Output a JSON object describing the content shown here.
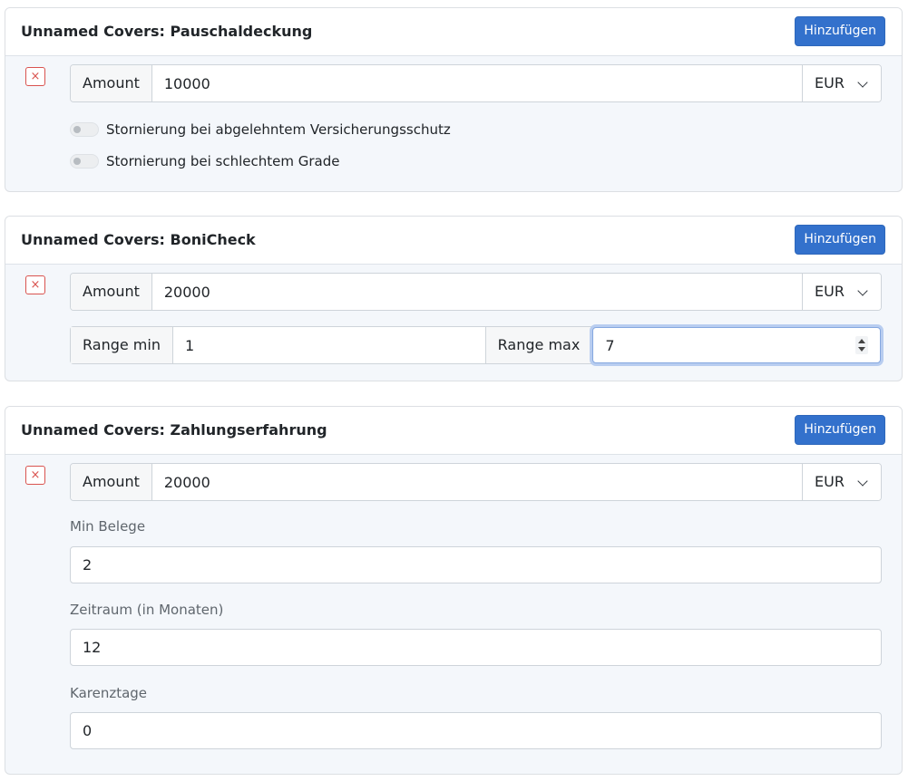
{
  "cards": [
    {
      "title": "Unnamed Covers: Pauschaldeckung",
      "add_label": "Hinzufügen",
      "remove_symbol": "×",
      "amount_label": "Amount",
      "amount_value": "10000",
      "currency": "EUR",
      "toggles": [
        {
          "label": "Stornierung bei abgelehntem Versicherungsschutz",
          "on": false
        },
        {
          "label": "Stornierung bei schlechtem Grade",
          "on": false
        }
      ]
    },
    {
      "title": "Unnamed Covers: BoniCheck",
      "add_label": "Hinzufügen",
      "remove_symbol": "×",
      "amount_label": "Amount",
      "amount_value": "20000",
      "currency": "EUR",
      "range_min_label": "Range min",
      "range_min_value": "1",
      "range_max_label": "Range max",
      "range_max_value": "7"
    },
    {
      "title": "Unnamed Covers: Zahlungserfahrung",
      "add_label": "Hinzufügen",
      "remove_symbol": "×",
      "amount_label": "Amount",
      "amount_value": "20000",
      "currency": "EUR",
      "fields": [
        {
          "label": "Min Belege",
          "value": "2"
        },
        {
          "label": "Zeitraum (in Monaten)",
          "value": "12"
        },
        {
          "label": "Karenztage",
          "value": "0"
        }
      ]
    }
  ],
  "colors": {
    "primary": "#3371cc",
    "danger": "#d9534f",
    "card_body_bg": "#f4f7fb",
    "focus_ring": "#b8cdf0"
  }
}
